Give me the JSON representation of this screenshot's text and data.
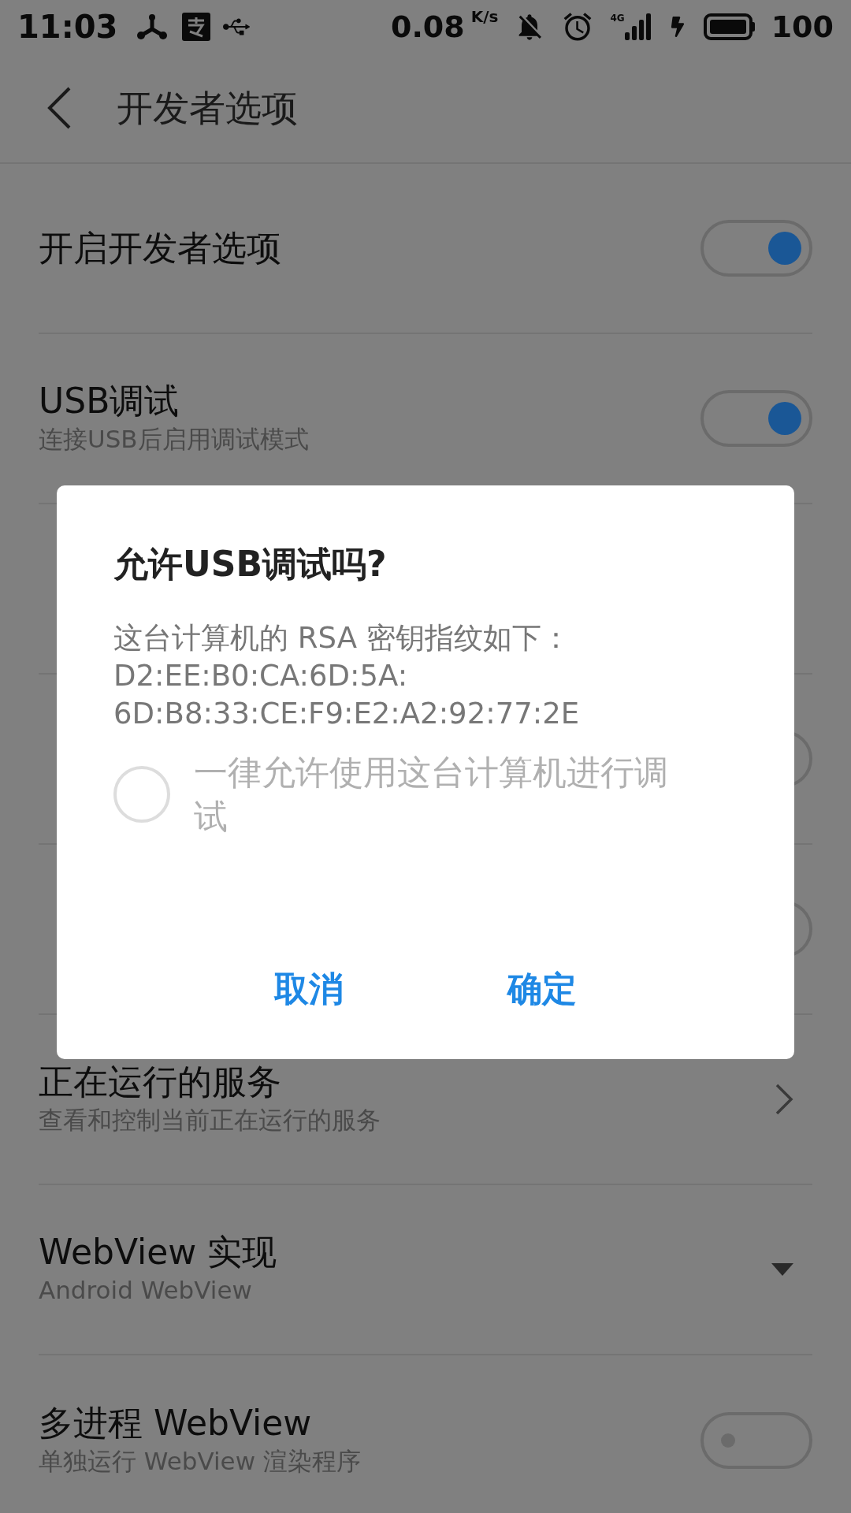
{
  "status_bar": {
    "time": "11:03",
    "speed": "0.08",
    "speed_unit": "K/s",
    "network": "4G",
    "battery": "100"
  },
  "header": {
    "title": "开发者选项"
  },
  "settings": [
    {
      "kind": "toggle",
      "title": "开启开发者选项",
      "on": true
    },
    {
      "kind": "toggle",
      "title": "USB调试",
      "subtitle": "连接USB后启用调试模式",
      "on": true
    },
    {
      "kind": "covered"
    },
    {
      "kind": "toggle",
      "on": false
    },
    {
      "kind": "toggle",
      "on": false
    },
    {
      "kind": "link",
      "title": "正在运行的服务",
      "subtitle": "查看和控制当前正在运行的服务"
    },
    {
      "kind": "dropdown",
      "title": "WebView 实现",
      "subtitle": "Android WebView"
    },
    {
      "kind": "toggle",
      "title": "多进程 WebView",
      "subtitle": "单独运行 WebView 渲染程序",
      "on": false
    }
  ],
  "dialog": {
    "title": "允许USB调试吗?",
    "message": [
      "这台计算机的 RSA 密钥指纹如下：",
      "D2:EE:B0:CA:6D:5A:",
      "6D:B8:33:CE:F9:E2:A2:92:77:2E"
    ],
    "checkbox": {
      "label": "一律允许使用这台计算机进行调试",
      "checked": false
    },
    "buttons": [
      "取消",
      "确定"
    ]
  }
}
